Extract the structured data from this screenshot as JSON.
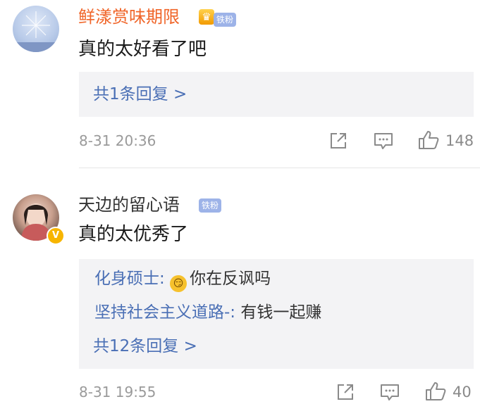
{
  "comments": [
    {
      "username": "鲜漾赏味期限",
      "fan_badge": "铁粉",
      "text": "真的太好看了吧",
      "replies": [],
      "more_replies": "共1条回复 >",
      "timestamp": "8-31 20:36",
      "likes": "148"
    },
    {
      "username": "天边的留心语",
      "fan_badge": "铁粉",
      "text": "真的太优秀了",
      "replies": [
        {
          "author": "化身硕士:",
          "text": "你在反讽吗"
        },
        {
          "author": "坚持社会主义道路-:",
          "text": "有钱一起赚"
        }
      ],
      "more_replies": "共12条回复 >",
      "timestamp": "8-31 19:55",
      "likes": "40"
    }
  ],
  "colors": {
    "vip_name": "#f06529",
    "link_blue": "#4a6fb5",
    "meta_gray": "#9a9a9a",
    "reply_bg": "#f3f3f5",
    "fan_badge": "#9db3e8"
  },
  "icons": [
    "crown-icon",
    "share-icon",
    "comment-icon",
    "like-icon",
    "verified-icon",
    "smirk-emoji-icon"
  ]
}
